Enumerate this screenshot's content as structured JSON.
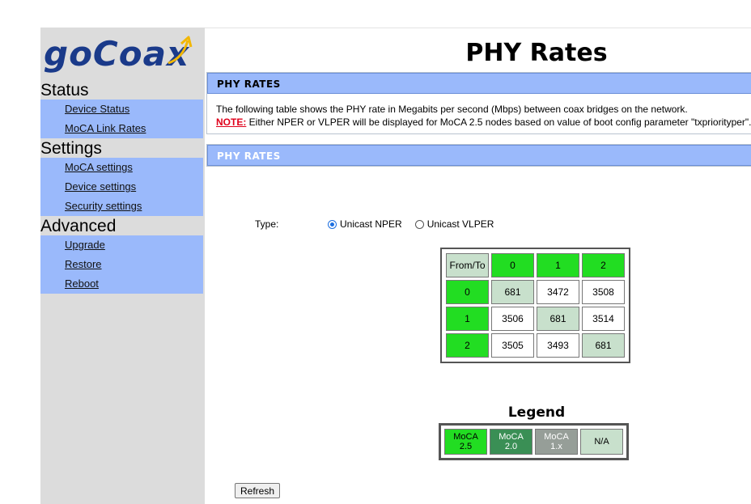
{
  "brand": {
    "logo_text": "goCoax",
    "logo_color": "#1a3a8a",
    "arrow_color": "#f2b705"
  },
  "sidebar": {
    "sections": [
      {
        "title": "Status",
        "items": [
          "Device Status",
          "MoCA Link Rates"
        ]
      },
      {
        "title": "Settings",
        "items": [
          "MoCA settings",
          "Device settings",
          "Security settings"
        ]
      },
      {
        "title": "Advanced",
        "items": [
          "Upgrade",
          "Restore",
          "Reboot"
        ]
      }
    ]
  },
  "page": {
    "title": "PHY Rates",
    "panel1_title": "PHY RATES",
    "description": "The following table shows the PHY rate in Megabits per second (Mbps) between coax bridges on the network.",
    "note_label": "NOTE:",
    "note_text": " Either NPER or VLPER will be displayed for MoCA 2.5 nodes based on value of boot config parameter \"txpriorityper\".",
    "panel2_title": "PHY RATES"
  },
  "type_selector": {
    "label": "Type:",
    "options": [
      {
        "label": "Unicast NPER",
        "checked": true
      },
      {
        "label": "Unicast VLPER",
        "checked": false
      }
    ]
  },
  "rates_table": {
    "corner": "From/To",
    "columns": [
      "0",
      "1",
      "2"
    ],
    "rows": [
      {
        "from": "0",
        "values": [
          "681",
          "3472",
          "3508"
        ]
      },
      {
        "from": "1",
        "values": [
          "3506",
          "681",
          "3514"
        ]
      },
      {
        "from": "2",
        "values": [
          "3505",
          "3493",
          "681"
        ]
      }
    ]
  },
  "legend": {
    "title": "Legend",
    "items": [
      {
        "label": "MoCA 2.5",
        "color": "#22dd22"
      },
      {
        "label": "MoCA 2.0",
        "color": "#3a8f55"
      },
      {
        "label": "MoCA 1.x",
        "color": "#969e98"
      },
      {
        "label": "N/A",
        "color": "#c8e0cc"
      }
    ]
  },
  "buttons": {
    "refresh": "Refresh"
  },
  "colors": {
    "nav_bg": "#9ab9fb",
    "sidebar_bg": "#dcdcdc",
    "header_green": "#22dd22",
    "diag_cell": "#c8e0cc"
  }
}
